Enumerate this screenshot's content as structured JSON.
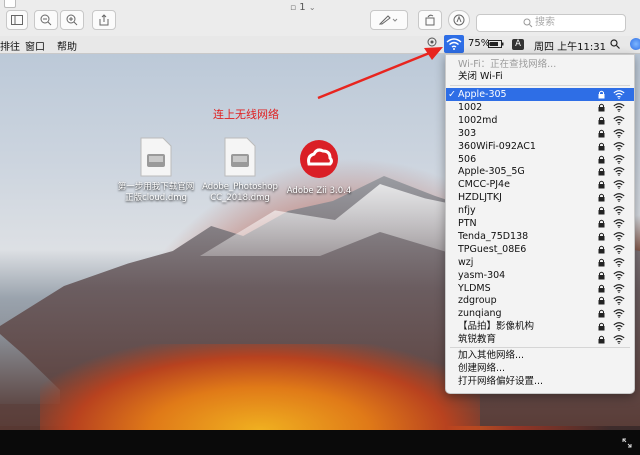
{
  "toolbar": {
    "title": "1",
    "search_placeholder": "搜索"
  },
  "menubar": {
    "items": [
      "排往",
      "窗口",
      "帮助"
    ],
    "battery": "75%",
    "keyboard": "A",
    "clock": "周四 上午11:31"
  },
  "desktop": {
    "annotation": "连上无线网络",
    "icons": [
      {
        "label_line1": "第一步用我下载官网",
        "label_line2": "正版cloud.dmg"
      },
      {
        "label_line1": "Adobe_Photoshop",
        "label_line2": "CC_2018.dmg"
      },
      {
        "label_line1": "Adobe Zii 3.0.4",
        "label_line2": ""
      }
    ]
  },
  "wifi_menu": {
    "status": "Wi-Fi：正在查找网络...",
    "toggle": "关闭 Wi-Fi",
    "networks": [
      {
        "name": "Apple-305",
        "selected": true,
        "locked": true
      },
      {
        "name": "1002",
        "locked": true
      },
      {
        "name": "1002md",
        "locked": true
      },
      {
        "name": "303",
        "locked": true
      },
      {
        "name": "360WiFi-092AC1",
        "locked": true
      },
      {
        "name": "506",
        "locked": true
      },
      {
        "name": "Apple-305_5G",
        "locked": true
      },
      {
        "name": "CMCC-PJ4e",
        "locked": true
      },
      {
        "name": "HZDLJTKJ",
        "locked": true
      },
      {
        "name": "nfjy",
        "locked": true
      },
      {
        "name": "PTN",
        "locked": true
      },
      {
        "name": "Tenda_75D138",
        "locked": true
      },
      {
        "name": "TPGuest_08E6",
        "locked": true
      },
      {
        "name": "wzj",
        "locked": true
      },
      {
        "name": "yasm-304",
        "locked": true
      },
      {
        "name": "YLDMS",
        "locked": true
      },
      {
        "name": "zdgroup",
        "locked": true
      },
      {
        "name": "zunqiang",
        "locked": true
      },
      {
        "name": "【品拍】影像机构",
        "locked": true
      },
      {
        "name": "筑锐教育",
        "locked": true
      }
    ],
    "actions": [
      "加入其他网络...",
      "创建网络...",
      "打开网络偏好设置..."
    ]
  },
  "colors": {
    "selection": "#2e6ee6",
    "annotation": "#e02020"
  }
}
